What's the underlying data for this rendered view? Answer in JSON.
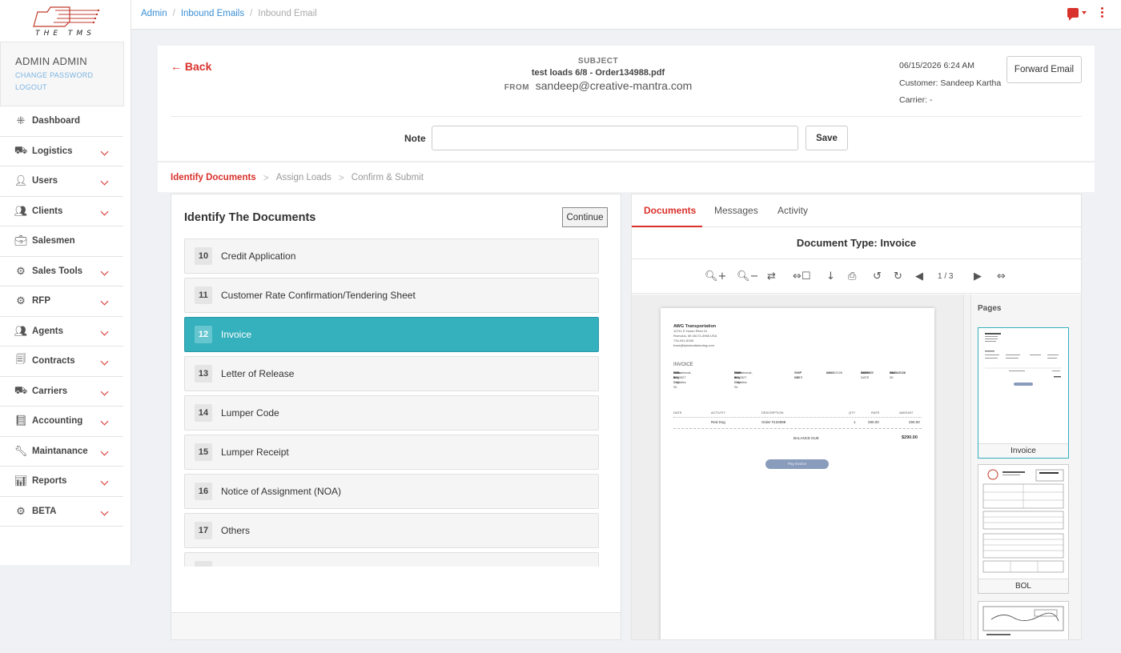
{
  "app": {
    "logo_text": "THE TMS"
  },
  "user": {
    "name": "ADMIN ADMIN",
    "change_password": "CHANGE PASSWORD",
    "logout": "LOGOUT"
  },
  "nav": [
    {
      "label": "Dashboard",
      "icon": "grid-icon",
      "expandable": false
    },
    {
      "label": "Logistics",
      "icon": "truck-icon",
      "expandable": true
    },
    {
      "label": "Users",
      "icon": "user-icon",
      "expandable": true
    },
    {
      "label": "Clients",
      "icon": "users-group-icon",
      "expandable": true
    },
    {
      "label": "Salesmen",
      "icon": "briefcase-icon",
      "expandable": false
    },
    {
      "label": "Sales Tools",
      "icon": "gears-icon",
      "expandable": true
    },
    {
      "label": "RFP",
      "icon": "gears-icon",
      "expandable": true
    },
    {
      "label": "Agents",
      "icon": "people-icon",
      "expandable": true
    },
    {
      "label": "Contracts",
      "icon": "documents-icon",
      "expandable": true
    },
    {
      "label": "Carriers",
      "icon": "truck-icon",
      "expandable": true
    },
    {
      "label": "Accounting",
      "icon": "book-icon",
      "expandable": true
    },
    {
      "label": "Maintanance",
      "icon": "wrench-icon",
      "expandable": true
    },
    {
      "label": "Reports",
      "icon": "bar-chart-icon",
      "expandable": true
    },
    {
      "label": "BETA",
      "icon": "gears-icon",
      "expandable": true
    }
  ],
  "breadcrumb": {
    "admin": "Admin",
    "inbound_emails": "Inbound Emails",
    "current": "Inbound Email"
  },
  "email": {
    "back": "← Back",
    "subject_label": "SUBJECT",
    "subject": "test loads 6/8 - Order134988.pdf",
    "from_label": "FROM",
    "from": "sandeep@creative-mantra.com",
    "datetime": "06/15/2026 6:24 AM",
    "customer": "Customer: Sandeep Kartha",
    "carrier": "Carrier: -",
    "forward_button": "Forward Email",
    "note_label": "Note",
    "note_value": "",
    "save_button": "Save"
  },
  "steps": {
    "step1": "Identify Documents",
    "step2": "Assign Loads",
    "step3": "Confirm & Submit",
    "separator": ">"
  },
  "identify": {
    "title": "Identify The Documents",
    "continue_button": "Continue",
    "items": [
      {
        "num": "10",
        "label": "Credit Application",
        "selected": false
      },
      {
        "num": "11",
        "label": "Customer Rate Confirmation/Tendering Sheet",
        "selected": false
      },
      {
        "num": "12",
        "label": "Invoice",
        "selected": true
      },
      {
        "num": "13",
        "label": "Letter of Release",
        "selected": false
      },
      {
        "num": "14",
        "label": "Lumper Code",
        "selected": false
      },
      {
        "num": "15",
        "label": "Lumper Receipt",
        "selected": false
      },
      {
        "num": "16",
        "label": "Notice of Assignment (NOA)",
        "selected": false
      },
      {
        "num": "17",
        "label": "Others",
        "selected": false
      },
      {
        "num": "",
        "label": "",
        "selected": false
      }
    ]
  },
  "viewer": {
    "tabs": {
      "documents": "Documents",
      "messages": "Messages",
      "activity": "Activity"
    },
    "doc_type": "Document Type: Invoice",
    "page_count": "1 / 3",
    "pages_title": "Pages",
    "thumbs": [
      "Invoice",
      "BOL"
    ],
    "invoice": {
      "company": "AWG Transportation",
      "addr1": "10711 E Huron River Dr",
      "addr2": "Romulus, MI 48174-3968 USA",
      "phone": "734-941-8348",
      "email": "trans@tylmanufacturing.com",
      "title": "INVOICE",
      "bill_to_label": "BILL TO",
      "bill_to": [
        "Red Dog Logistics",
        "800 W 79th St.",
        "Suite 4",
        "Willowbrook, IL 60527"
      ],
      "ship_to_label": "SHIP TO",
      "ship_to": [
        "Red Dog Logistics",
        "800 W 79th St.",
        "Suite 4",
        "Willowbrook, IL 60527"
      ],
      "ship_date_label": "SHIP DATE",
      "ship_date": "04/24/2026",
      "ship_via_label": "SHIP VIA",
      "ship_via": "AWG",
      "invoice_label": "INVOICE",
      "invoice_no": "9119",
      "date_label": "DATE",
      "date": "04/24/2026",
      "terms_label": "TERMS",
      "terms": "Net 30",
      "due_label": "DUE DATE",
      "due": "05/24/2026",
      "col_date": "DATE",
      "col_activity": "ACTIVITY",
      "col_desc": "DESCRIPTION",
      "col_qty": "QTY",
      "col_rate": "RATE",
      "col_amount": "AMOUNT",
      "row_activity": "Red Dog",
      "row_desc": "Order #134988",
      "row_qty": "1",
      "row_rate": "290.00",
      "row_amount": "290.00",
      "balance_label": "BALANCE DUE",
      "balance": "$290.00",
      "pay_button": "Pay invoice"
    }
  },
  "colors": {
    "accent": "#d9312b",
    "selected": "#35b0bd",
    "link": "#3a8fd4"
  }
}
